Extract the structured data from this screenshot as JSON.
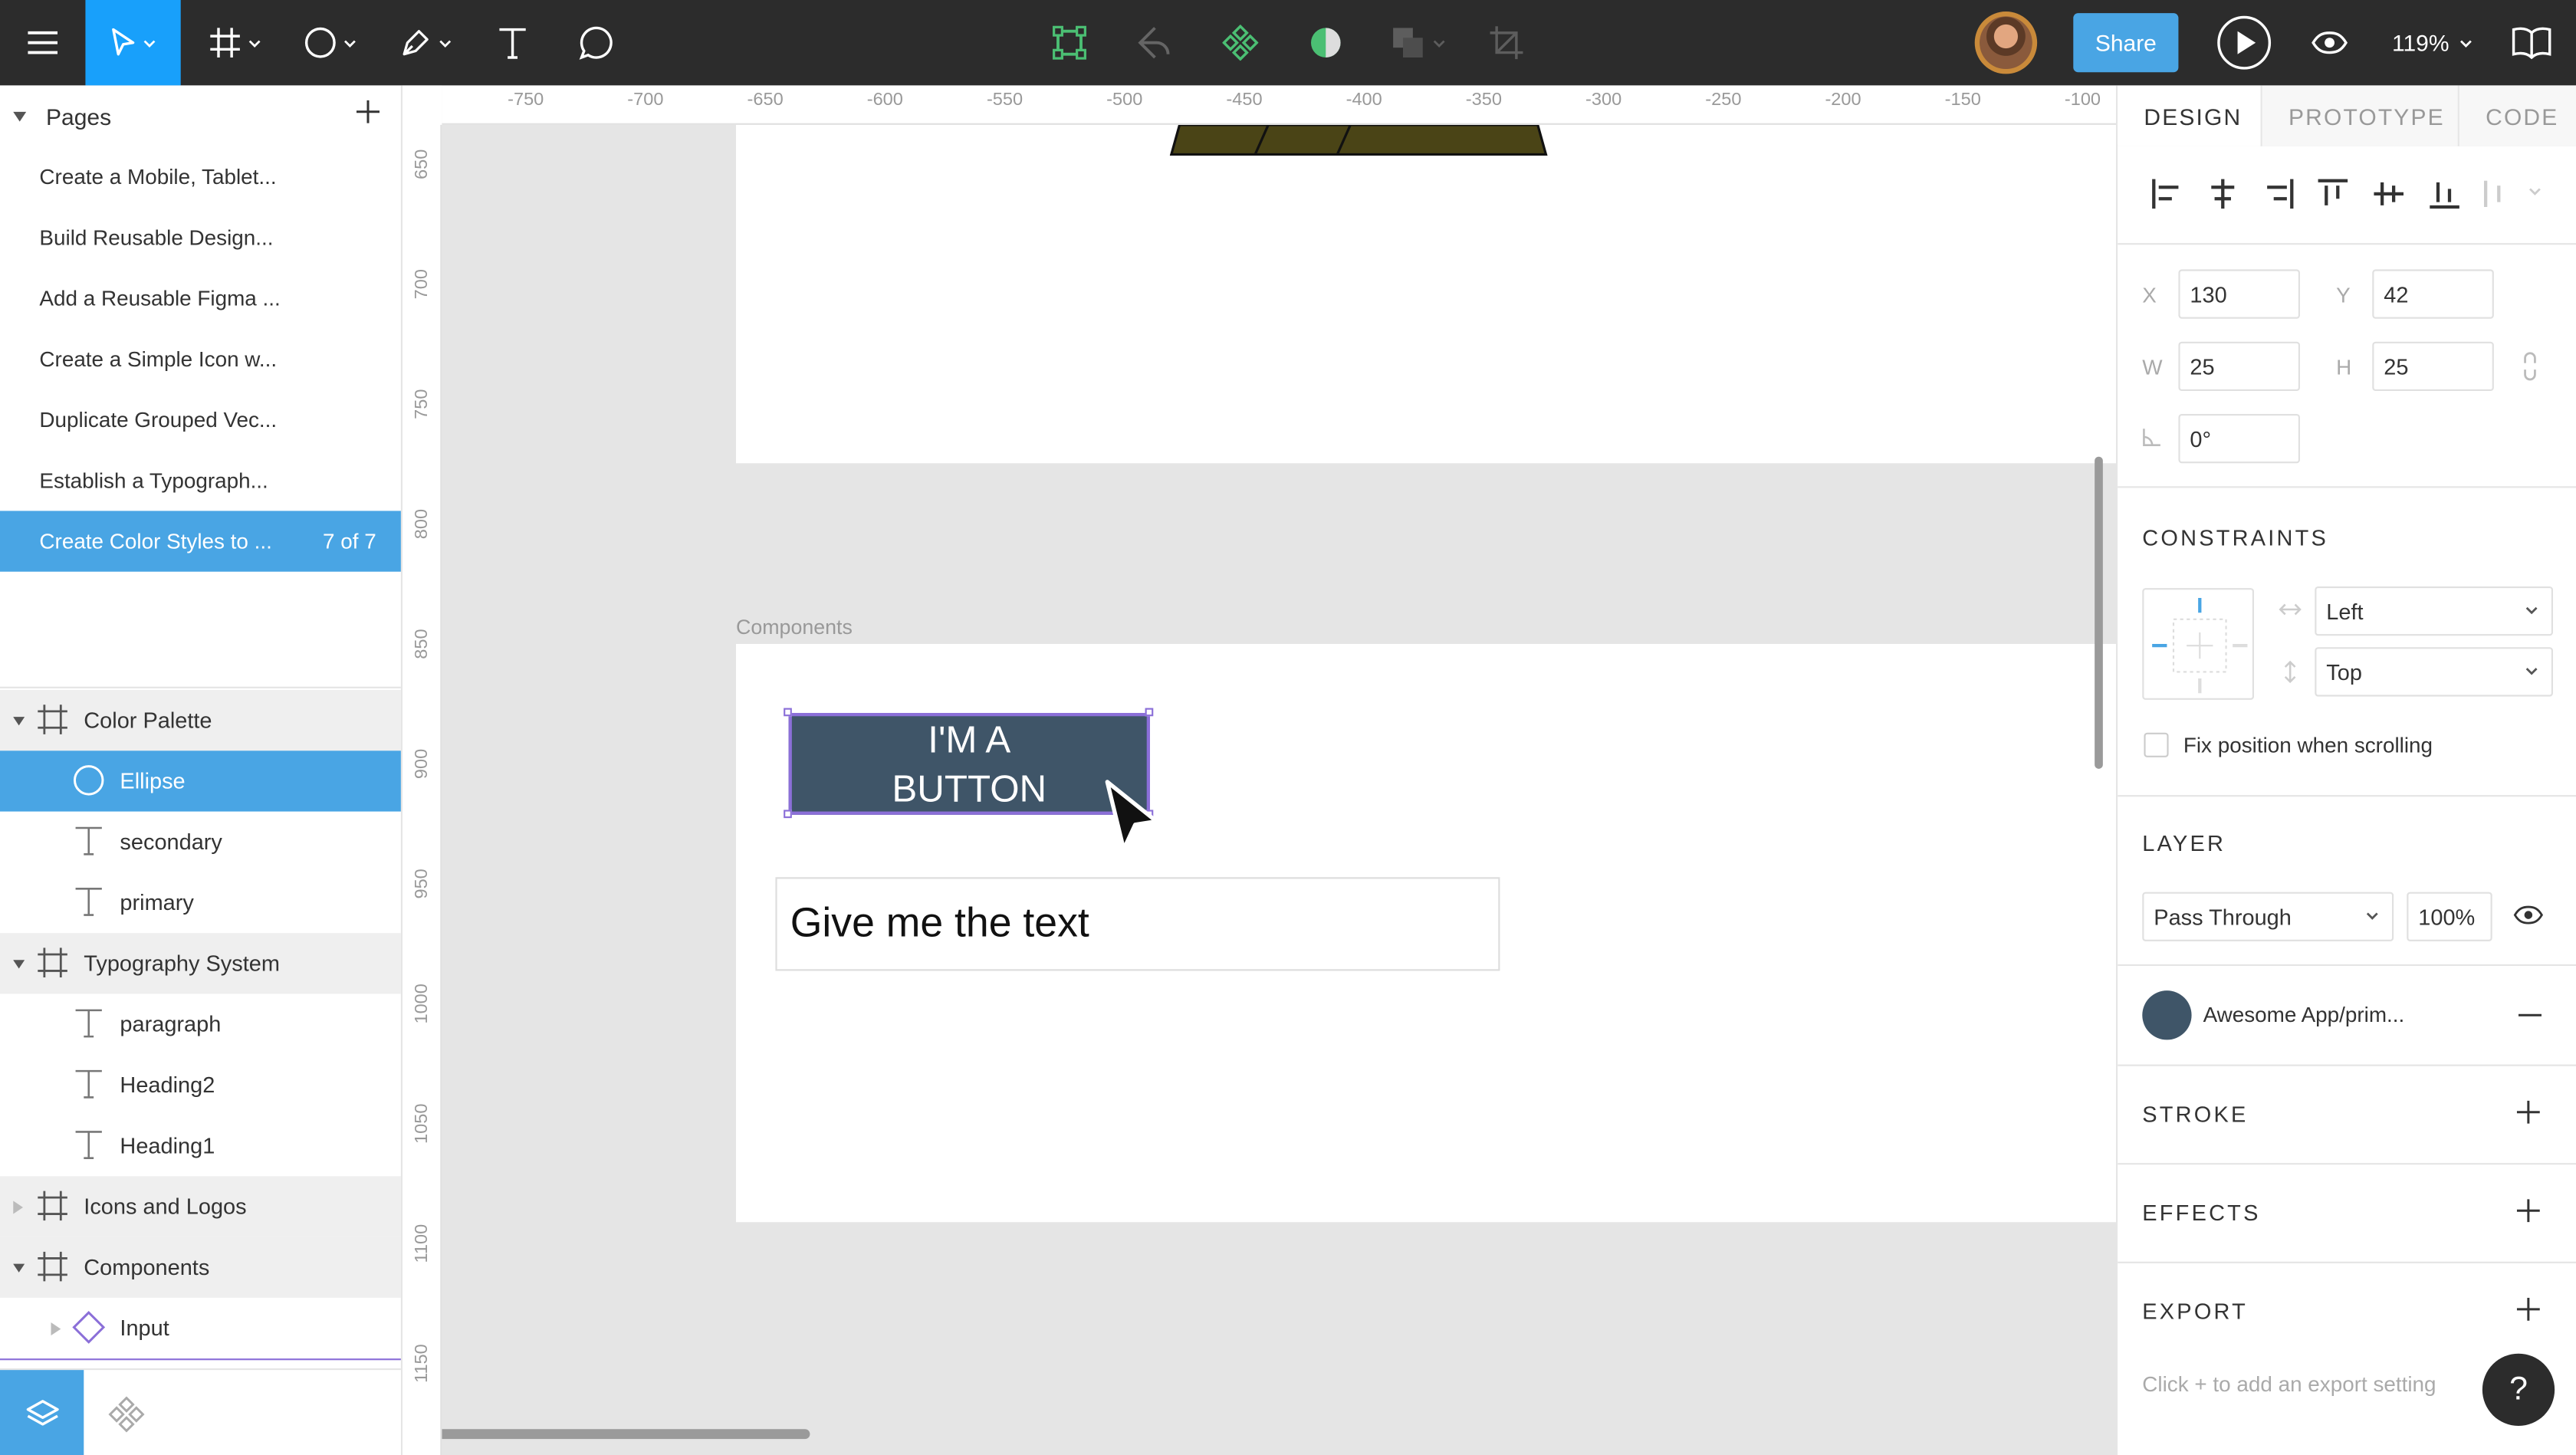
{
  "toolbar": {
    "share_label": "Share",
    "zoom": "119%",
    "active_tool": "move",
    "colors": {
      "bar": "#2c2c2c",
      "active_tool_bg": "#18a0fb",
      "accent": "#49a5e4",
      "component_green": "#4bbf73"
    }
  },
  "pages": {
    "header": "Pages",
    "items": [
      {
        "label": "Create a Mobile, Tablet..."
      },
      {
        "label": "Build Reusable Design..."
      },
      {
        "label": "Add a Reusable Figma ..."
      },
      {
        "label": "Create a Simple Icon w..."
      },
      {
        "label": "Duplicate Grouped Vec..."
      },
      {
        "label": "Establish a Typograph..."
      },
      {
        "label": "Create Color Styles to ...",
        "count": "7 of 7"
      }
    ]
  },
  "layers": [
    {
      "label": "Color Palette",
      "type": "frame"
    },
    {
      "label": "Ellipse",
      "type": "ellipse"
    },
    {
      "label": "secondary",
      "type": "text"
    },
    {
      "label": "primary",
      "type": "text"
    },
    {
      "label": "Typography System",
      "type": "frame"
    },
    {
      "label": "paragraph",
      "type": "text"
    },
    {
      "label": "Heading2",
      "type": "text"
    },
    {
      "label": "Heading1",
      "type": "text"
    },
    {
      "label": "Icons and Logos",
      "type": "frame"
    },
    {
      "label": "Components",
      "type": "frame"
    },
    {
      "label": "Input",
      "type": "component"
    }
  ],
  "ruler": {
    "x": [
      "-750",
      "-700",
      "-650",
      "-600",
      "-550",
      "-500",
      "-450",
      "-400",
      "-350",
      "-300",
      "-250",
      "-200",
      "-150",
      "-100"
    ],
    "y": [
      "650",
      "700",
      "750",
      "800",
      "850",
      "900",
      "950",
      "1000",
      "1050",
      "1100",
      "1150"
    ]
  },
  "canvas": {
    "frame_label": "Components",
    "button_line1": "I'M A",
    "button_line2": "BUTTON",
    "input_text": "Give me the text",
    "button_color": "#3f5568"
  },
  "design": {
    "tabs": [
      "DESIGN",
      "PROTOTYPE",
      "CODE"
    ],
    "x_label": "X",
    "x": "130",
    "y_label": "Y",
    "y": "42",
    "w_label": "W",
    "w": "25",
    "h_label": "H",
    "h": "25",
    "rotation": "0°",
    "constraints_title": "CONSTRAINTS",
    "horizontal": "Left",
    "vertical": "Top",
    "fix_position": "Fix position when scrolling",
    "layer_title": "LAYER",
    "blend": "Pass Through",
    "opacity": "100%",
    "fill_style": "Awesome App/prim...",
    "stroke_title": "STROKE",
    "effects_title": "EFFECTS",
    "export_title": "EXPORT",
    "export_hint": "Click + to add an export setting",
    "help": "?"
  }
}
